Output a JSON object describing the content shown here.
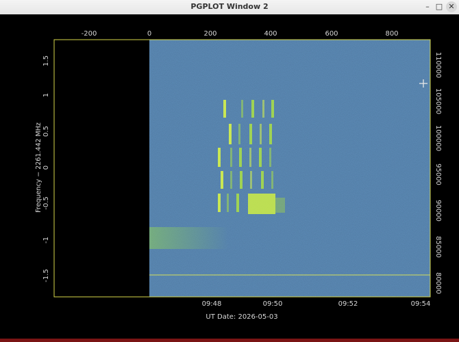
{
  "window": {
    "title": "PGPLOT Window 2",
    "minimize_glyph": "–",
    "maximize_glyph": "□",
    "close_glyph": "✕"
  },
  "plot": {
    "top_axis_ticks": [
      "-200",
      "0",
      "200",
      "400",
      "600",
      "800"
    ],
    "left_axis_ticks": [
      "1.5",
      "1",
      "0.5",
      "0",
      "-0.5",
      "-1",
      "-1.5"
    ],
    "right_axis_ticks": [
      "110000",
      "105000",
      "100000",
      "95000",
      "90000",
      "85000",
      "80000"
    ],
    "bottom_axis_ticks": [
      "09:48",
      "09:50",
      "09:52",
      "09:54"
    ],
    "ylabel": "Frequency − 2261.442 MHz",
    "xlabel": "UT Date: 2026-05-03",
    "colors": {
      "background_field": "#2f5886",
      "axis": "#d8d84a",
      "label": "#d8d8d8",
      "signal": "#d6f24a"
    }
  }
}
